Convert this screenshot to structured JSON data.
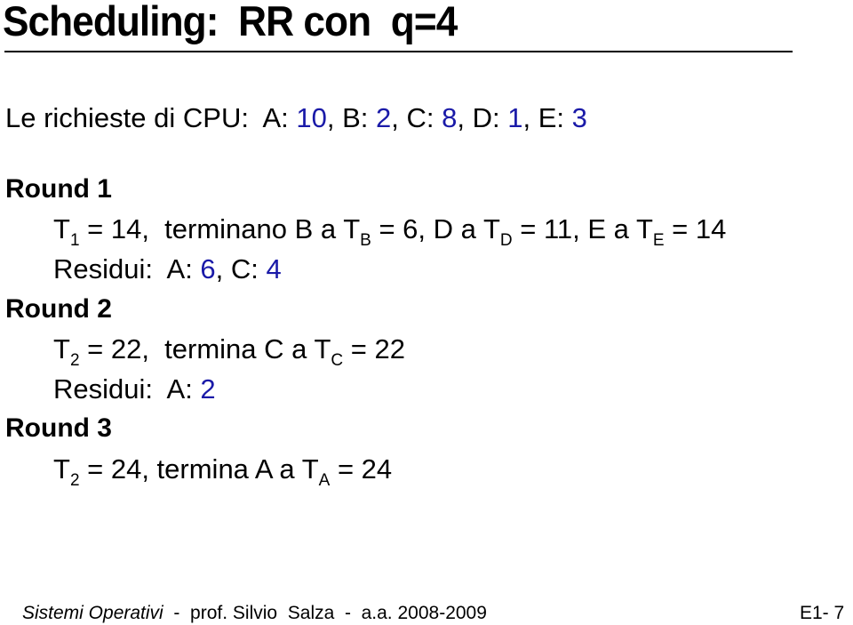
{
  "slide": {
    "title": "Scheduling:  RR con  q=4",
    "intro": {
      "label": "Le richieste di CPU:  ",
      "requests": [
        {
          "proc": "A: ",
          "value": "10",
          "sep": ", "
        },
        {
          "proc": "B: ",
          "value": "2",
          "sep": ", "
        },
        {
          "proc": "C: ",
          "value": "8",
          "sep": ", "
        },
        {
          "proc": "D: ",
          "value": "1",
          "sep": ", "
        },
        {
          "proc": "E: ",
          "value": "3",
          "sep": ""
        }
      ]
    },
    "rounds": [
      {
        "header": "Round 1",
        "line1": {
          "t": "T",
          "t_sub": "1",
          "t_rest": " = 14,  terminano B a ",
          "tb": "T",
          "tb_sub": "B",
          "tb_rest": " = 6, D a ",
          "td": "T",
          "td_sub": "D",
          "td_rest": " = 11, E a ",
          "te": "T",
          "te_sub": "E",
          "te_rest": " = 14"
        },
        "residui": {
          "label": "Residui:  ",
          "a_label": "A: ",
          "a_value": "6",
          "sep": ", ",
          "c_label": "C: ",
          "c_value": "4"
        }
      },
      {
        "header": "Round 2",
        "line1": {
          "t": "T",
          "t_sub": "2",
          "t_rest": " = 22,  termina C a ",
          "tc": "T",
          "tc_sub": "C",
          "tc_rest": " = 22"
        },
        "residui": {
          "label": "Residui:  ",
          "a_label": "A: ",
          "a_value": "2"
        }
      },
      {
        "header": "Round 3",
        "line1": {
          "t": "T",
          "t_sub": "2",
          "t_rest": " = 24, termina A a ",
          "ta": "T",
          "ta_sub": "A",
          "ta_rest": " = 24"
        }
      }
    ],
    "footer": {
      "course": "Sistemi Operativi",
      "rest": "  -  prof. Silvio  Salza  -  a.a. 2008-2009",
      "page": "E1- 7"
    },
    "colors": {
      "value_blue": "#1a1aa8",
      "text": "#000000"
    }
  }
}
